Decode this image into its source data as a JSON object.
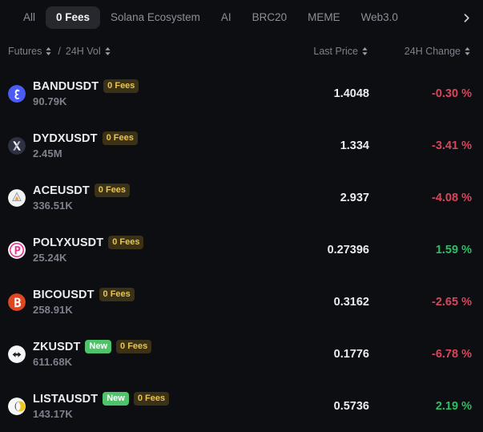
{
  "tabs": {
    "items": [
      {
        "label": "All",
        "active": false
      },
      {
        "label": "0 Fees",
        "active": true
      },
      {
        "label": "Solana Ecosystem",
        "active": false
      },
      {
        "label": "AI",
        "active": false
      },
      {
        "label": "BRC20",
        "active": false
      },
      {
        "label": "MEME",
        "active": false
      },
      {
        "label": "Web3.0",
        "active": false
      }
    ],
    "next_icon": "chevron-right-icon"
  },
  "columns": {
    "futures": "Futures",
    "separator": "/",
    "volume": "24H Vol",
    "last_price": "Last Price",
    "change": "24H Change",
    "sort_icon": "sort-arrows-icon"
  },
  "colors": {
    "background": "#0c0e12",
    "active_tab_bg": "#26282e",
    "fees_badge_bg": "#3a3116",
    "fees_badge_text": "#e9c451",
    "new_badge_bg": "#4ec46a",
    "up": "#2ebd63",
    "down": "#d9455b",
    "muted_text": "#7d818b",
    "primary_text": "#eaecef"
  },
  "rows": [
    {
      "symbol": "BANDUSDT",
      "volume": "90.79K",
      "price": "1.4048",
      "change": "-0.30 %",
      "direction": "down",
      "is_new": false,
      "zero_fees": "0 Fees",
      "icon": "band-protocol-icon"
    },
    {
      "symbol": "DYDXUSDT",
      "volume": "2.45M",
      "price": "1.334",
      "change": "-3.41 %",
      "direction": "down",
      "is_new": false,
      "zero_fees": "0 Fees",
      "icon": "dydx-icon"
    },
    {
      "symbol": "ACEUSDT",
      "volume": "336.51K",
      "price": "2.937",
      "change": "-4.08 %",
      "direction": "down",
      "is_new": false,
      "zero_fees": "0 Fees",
      "icon": "fusionist-ace-icon"
    },
    {
      "symbol": "POLYXUSDT",
      "volume": "25.24K",
      "price": "0.27396",
      "change": "1.59 %",
      "direction": "up",
      "is_new": false,
      "zero_fees": "0 Fees",
      "icon": "polymesh-icon"
    },
    {
      "symbol": "BICOUSDT",
      "volume": "258.91K",
      "price": "0.3162",
      "change": "-2.65 %",
      "direction": "down",
      "is_new": false,
      "zero_fees": "0 Fees",
      "icon": "biconomy-icon"
    },
    {
      "symbol": "ZKUSDT",
      "volume": "611.68K",
      "price": "0.1776",
      "change": "-6.78 %",
      "direction": "down",
      "is_new": true,
      "new_label": "New",
      "zero_fees": "0 Fees",
      "icon": "zksync-icon"
    },
    {
      "symbol": "LISTAUSDT",
      "volume": "143.17K",
      "price": "0.5736",
      "change": "2.19 %",
      "direction": "up",
      "is_new": true,
      "new_label": "New",
      "zero_fees": "0 Fees",
      "icon": "lista-dao-icon"
    }
  ]
}
